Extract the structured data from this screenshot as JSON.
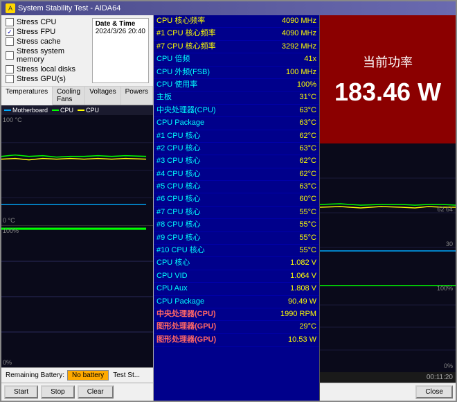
{
  "window": {
    "title": "System Stability Test - AIDA64"
  },
  "left": {
    "stress_label": "CPU",
    "checkboxes": [
      {
        "label": "Stress CPU",
        "checked": false
      },
      {
        "label": "Stress FPU",
        "checked": true
      },
      {
        "label": "Stress cache",
        "checked": false
      },
      {
        "label": "Stress system memory",
        "checked": false
      },
      {
        "label": "Stress local disks",
        "checked": false
      },
      {
        "label": "Stress GPU(s)",
        "checked": false
      }
    ],
    "datetime_label": "Date & Time",
    "datetime_value": "2024/3/26 20:40",
    "tabs": [
      "Temperatures",
      "Cooling Fans",
      "Voltages",
      "Powers"
    ],
    "legend": [
      {
        "label": "Motherboard",
        "color": "#00aaff"
      },
      {
        "label": "CPU",
        "color": "#00ff00"
      },
      {
        "label": "CPU",
        "color": "#ffff00"
      }
    ],
    "chart_top_label": "100 °C",
    "chart_bottom_label": "0 °C",
    "chart_right_label": "",
    "bottom": {
      "battery_label": "Remaining Battery:",
      "battery_value": "No battery",
      "test_status": "Test St..."
    },
    "buttons": [
      "Start",
      "Stop",
      "Clear"
    ]
  },
  "metrics": [
    {
      "label": "CPU 核心频率",
      "value": "4090 MHz",
      "highlight": true
    },
    {
      "label": "#1 CPU 核心频率",
      "value": "4090 MHz",
      "highlight": true
    },
    {
      "label": "#7 CPU 核心频率",
      "value": "3292 MHz",
      "highlight": true
    },
    {
      "label": "CPU 倍频",
      "value": "41x",
      "highlight": false
    },
    {
      "label": "CPU 外频(FSB)",
      "value": "100 MHz",
      "highlight": false
    },
    {
      "label": "CPU 使用率",
      "value": "100%",
      "highlight": false
    },
    {
      "label": "主板",
      "value": "31°C",
      "highlight": false
    },
    {
      "label": "中央处理器(CPU)",
      "value": "63°C",
      "highlight": false
    },
    {
      "label": "CPU Package",
      "value": "63°C",
      "highlight": false
    },
    {
      "label": "#1 CPU 核心",
      "value": "62°C",
      "highlight": false
    },
    {
      "label": "#2 CPU 核心",
      "value": "63°C",
      "highlight": false
    },
    {
      "label": "#3 CPU 核心",
      "value": "62°C",
      "highlight": false
    },
    {
      "label": "#4 CPU 核心",
      "value": "62°C",
      "highlight": false
    },
    {
      "label": "#5 CPU 核心",
      "value": "63°C",
      "highlight": false
    },
    {
      "label": "#6 CPU 核心",
      "value": "60°C",
      "highlight": false
    },
    {
      "label": "#7 CPU 核心",
      "value": "55°C",
      "highlight": false
    },
    {
      "label": "#8 CPU 核心",
      "value": "55°C",
      "highlight": false
    },
    {
      "label": "#9 CPU 核心",
      "value": "55°C",
      "highlight": false
    },
    {
      "label": "#10 CPU 核心",
      "value": "55°C",
      "highlight": false
    },
    {
      "label": "CPU 核心",
      "value": "1.082 V",
      "highlight": false
    },
    {
      "label": "CPU VID",
      "value": "1.064 V",
      "highlight": false
    },
    {
      "label": "CPU Aux",
      "value": "1.808 V",
      "highlight": false
    },
    {
      "label": "CPU Package",
      "value": "90.49 W",
      "highlight": false
    },
    {
      "label": "中央处理器(CPU)",
      "value": "1990 RPM",
      "red": true
    },
    {
      "label": "图形处理器(GPU)",
      "value": "29°C",
      "red": true
    },
    {
      "label": "图形处理器(GPU)",
      "value": "10.53 W",
      "red": true
    }
  ],
  "right": {
    "power_label": "当前功率",
    "power_value": "183.46 W",
    "chart_label_62": "62 64",
    "chart_label_30": "30",
    "chart_label_100pct": "100%",
    "chart_label_0pct": "0%",
    "timer": "00:11:20",
    "close_button": "Close"
  }
}
